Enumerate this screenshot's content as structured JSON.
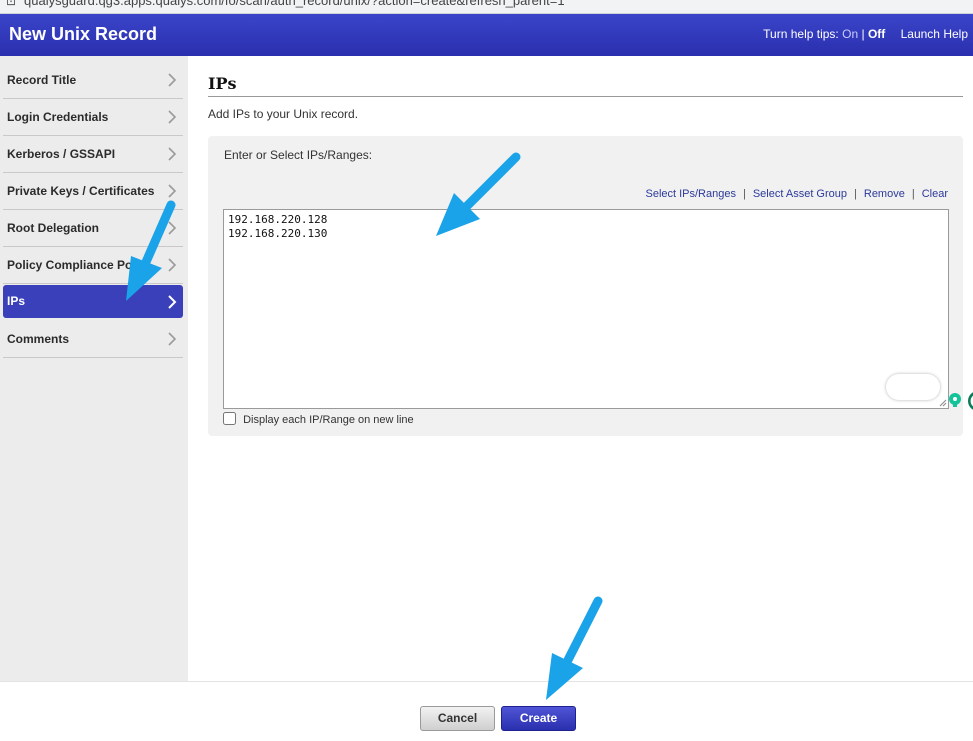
{
  "browser": {
    "url": "qualysguard.qg3.apps.qualys.com/fo/scan/auth_record/unix/?action=create&refresh_parent=1"
  },
  "header": {
    "title": "New Unix Record",
    "help_tips_label": "Turn help tips:",
    "help_on": "On",
    "help_separator": "|",
    "help_off": "Off",
    "launch_help": "Launch Help"
  },
  "sidebar": {
    "items": [
      {
        "label": "Record Title",
        "active": false
      },
      {
        "label": "Login Credentials",
        "active": false
      },
      {
        "label": "Kerberos / GSSAPI",
        "active": false
      },
      {
        "label": "Private Keys / Certificates",
        "active": false
      },
      {
        "label": "Root Delegation",
        "active": false
      },
      {
        "label": "Policy Compliance Ports",
        "active": false
      },
      {
        "label": "IPs",
        "active": true
      },
      {
        "label": "Comments",
        "active": false
      }
    ]
  },
  "main": {
    "section_title": "IPs",
    "description": "Add IPs to your Unix record.",
    "panel_label": "Enter or Select IPs/Ranges:",
    "links": {
      "select_ips": "Select IPs/Ranges",
      "select_asset_group": "Select Asset Group",
      "remove": "Remove",
      "clear": "Clear",
      "separator": "|"
    },
    "ip_entries": [
      "192.168.220.128",
      "192.168.220.130"
    ],
    "checkbox_label": "Display each IP/Range on new line",
    "checkbox_checked": false
  },
  "footer": {
    "cancel_label": "Cancel",
    "create_label": "Create"
  },
  "colors": {
    "header_blue": "#2a2fae",
    "active_nav": "#3a40b9",
    "link_blue": "#2c3a9b",
    "annotation_arrow": "#1aa3e8"
  },
  "icons": {
    "nav_chevron": "chevron-right-icon",
    "grammarly": "grammarly-icon",
    "resize": "resize-handle-icon"
  }
}
